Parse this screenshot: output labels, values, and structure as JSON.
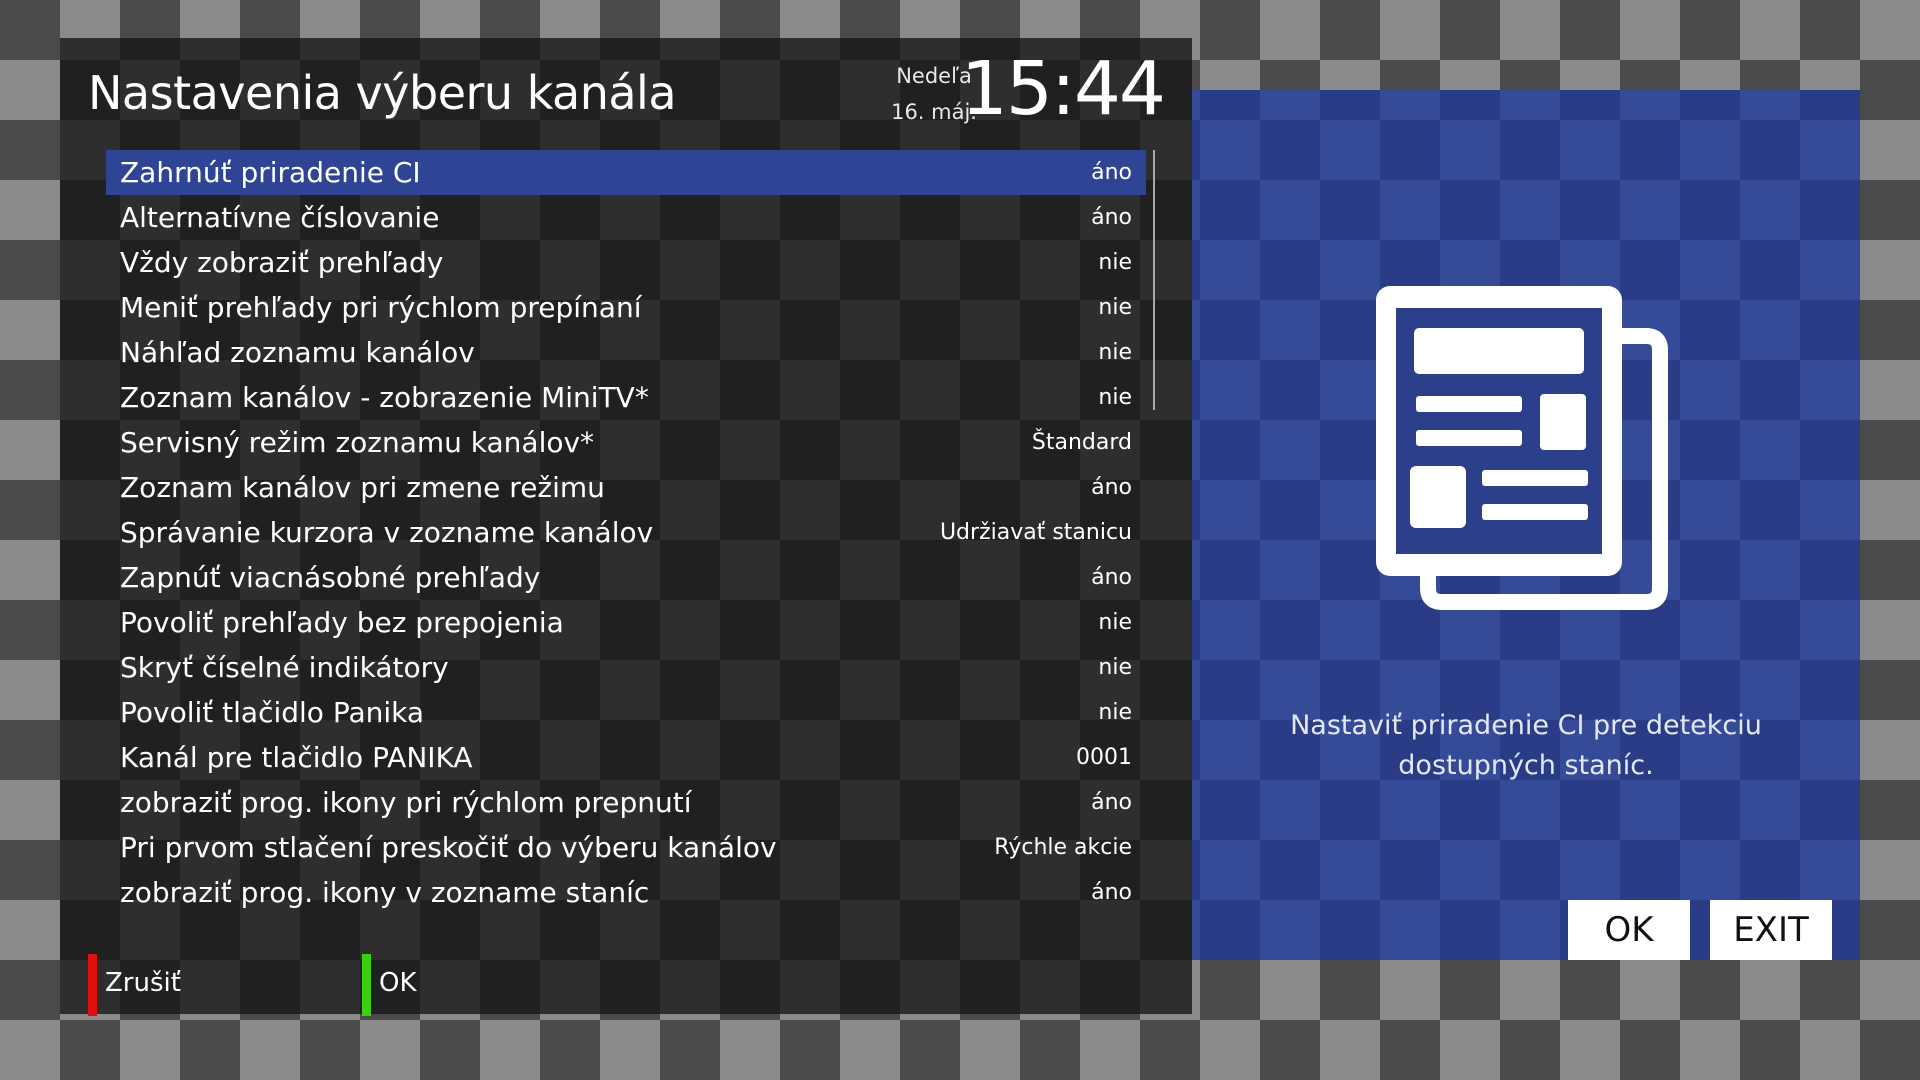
{
  "header": {
    "title": "Nastavenia výberu kanála",
    "day": "Nedeľa",
    "date": "16. máj.",
    "time": "15:44"
  },
  "menu": {
    "items": [
      {
        "label": "Zahrnúť priradenie CI",
        "value": "áno"
      },
      {
        "label": "Alternatívne číslovanie",
        "value": "áno"
      },
      {
        "label": "Vždy zobraziť prehľady",
        "value": "nie"
      },
      {
        "label": "Meniť prehľady pri rýchlom prepínaní",
        "value": "nie"
      },
      {
        "label": "Náhľad zoznamu kanálov",
        "value": "nie"
      },
      {
        "label": "Zoznam kanálov - zobrazenie MiniTV*",
        "value": "nie"
      },
      {
        "label": "Servisný režim zoznamu kanálov*",
        "value": "Štandard"
      },
      {
        "label": "Zoznam kanálov pri zmene režimu",
        "value": "áno"
      },
      {
        "label": "Správanie kurzora v zozname kanálov",
        "value": "Udržiavať stanicu"
      },
      {
        "label": "Zapnúť viacnásobné prehľady",
        "value": "áno"
      },
      {
        "label": "Povoliť prehľady bez prepojenia",
        "value": "nie"
      },
      {
        "label": "Skryť číselné indikátory",
        "value": "nie"
      },
      {
        "label": "Povoliť tlačidlo Panika",
        "value": "nie"
      },
      {
        "label": "Kanál pre tlačidlo PANIKA",
        "value": "0001"
      },
      {
        "label": "zobraziť prog. ikony pri rýchlom prepnutí",
        "value": "áno"
      },
      {
        "label": "Pri prvom stlačení preskočiť do výberu kanálov",
        "value": "Rýchle akcie"
      },
      {
        "label": "zobraziť prog. ikony v zozname staníc",
        "value": "áno"
      }
    ],
    "selected_index": 0
  },
  "footer": {
    "red_label": "Zrušiť",
    "green_label": "OK"
  },
  "help": {
    "icon": "newspaper-icon",
    "text": "Nastaviť priradenie CI pre detekciu dostupných staníc."
  },
  "buttons": {
    "ok": "OK",
    "exit": "EXIT"
  },
  "colors": {
    "selection": "#2f4495",
    "info_panel": "#2c3f8a",
    "red_key": "#e01010",
    "green_key": "#3ad010"
  }
}
